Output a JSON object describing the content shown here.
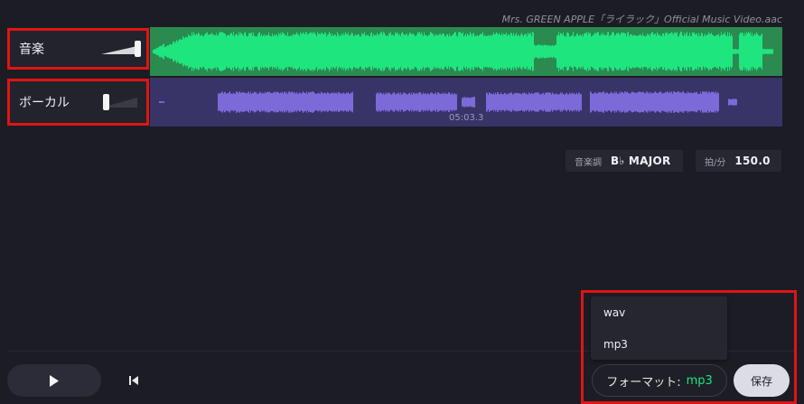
{
  "header": {
    "filename": "Mrs. GREEN APPLE「ライラック」Official Music Video.aac"
  },
  "tracks": [
    {
      "name": "音楽",
      "volume": 1.0,
      "color": "#1fe57f",
      "bg": "#2b8a50"
    },
    {
      "name": "ボーカル",
      "volume": 0.05,
      "color": "#7c6ad8",
      "bg": "#383468"
    }
  ],
  "waveform": {
    "timecode": "05:03.3"
  },
  "info": {
    "key_label": "音楽調",
    "key_value": "B♭ MAJOR",
    "tempo_label": "拍/分",
    "tempo_value": "150.0"
  },
  "format": {
    "options": [
      "wav",
      "mp3"
    ],
    "label": "フォーマット:",
    "selected": "mp3"
  },
  "controls": {
    "play_icon": "play-icon",
    "skip_icon": "skip-to-start-icon",
    "save_label": "保存"
  },
  "colors": {
    "accent": "#19e582",
    "highlight": "#e01414"
  }
}
